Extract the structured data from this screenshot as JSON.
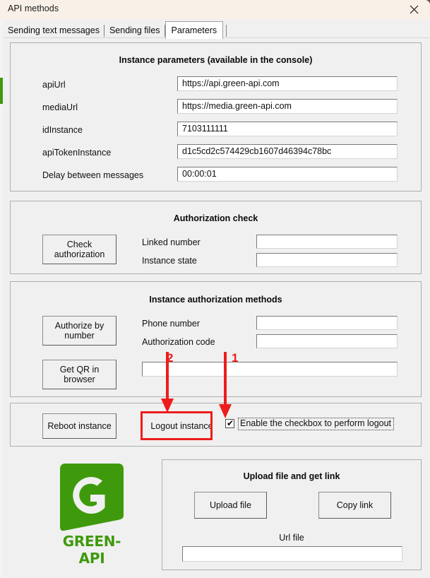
{
  "window": {
    "title": "API methods",
    "close_icon": "close-icon"
  },
  "tabs": [
    {
      "label": "Sending text messages",
      "selected": false
    },
    {
      "label": "Sending files",
      "selected": false
    },
    {
      "label": "Parameters",
      "selected": true
    }
  ],
  "instance_parameters": {
    "title": "Instance parameters (available in the console)",
    "fields": [
      {
        "label": "apiUrl",
        "value": "https://api.green-api.com"
      },
      {
        "label": "mediaUrl",
        "value": "https://media.green-api.com"
      },
      {
        "label": "idInstance",
        "value": "7103111111"
      },
      {
        "label": "apiTokenInstance",
        "value": "d1c5cd2c574429cb1607d46394c78bc"
      },
      {
        "label": "Delay between messages",
        "value": "00:00:01"
      }
    ]
  },
  "authorization_check": {
    "title": "Authorization check",
    "button": "Check authorization",
    "button_line1": "Check",
    "button_line2": "authorization",
    "fields": [
      {
        "label": "Linked number",
        "value": ""
      },
      {
        "label": "Instance state",
        "value": ""
      }
    ]
  },
  "authorization_methods": {
    "title": "Instance authorization methods",
    "buttons": [
      {
        "label": "Authorize by number",
        "line1": "Authorize by",
        "line2": "number"
      },
      {
        "label": "Get QR in browser",
        "line1": "Get QR in",
        "line2": "browser"
      }
    ],
    "fields": [
      {
        "label": "Phone number",
        "value": ""
      },
      {
        "label": "Authorization code",
        "value": ""
      }
    ],
    "wide_field": {
      "label": "",
      "value": ""
    }
  },
  "logout_section": {
    "reboot_button": "Reboot instance",
    "logout_button": "Logout instance",
    "checkbox": {
      "label": "Enable the checkbox to perform logout",
      "checked": true,
      "tick": "✔"
    }
  },
  "upload_section": {
    "title": "Upload file and get link",
    "upload_button": "Upload file",
    "copy_button": "Copy link",
    "url_label": "Url file",
    "url_value": ""
  },
  "logo": {
    "wordmark": "GREEN-API",
    "letter": "G",
    "color": "#3e9a0c"
  },
  "annotations": [
    {
      "number": "1",
      "target": "logout-checkbox"
    },
    {
      "number": "2",
      "target": "logout-instance-button"
    }
  ],
  "colors": {
    "accent_red": "#ee1c1c",
    "brand_green": "#3e9a0c",
    "titlebar": "#f9f1e7",
    "surface": "#f0f0f0"
  }
}
